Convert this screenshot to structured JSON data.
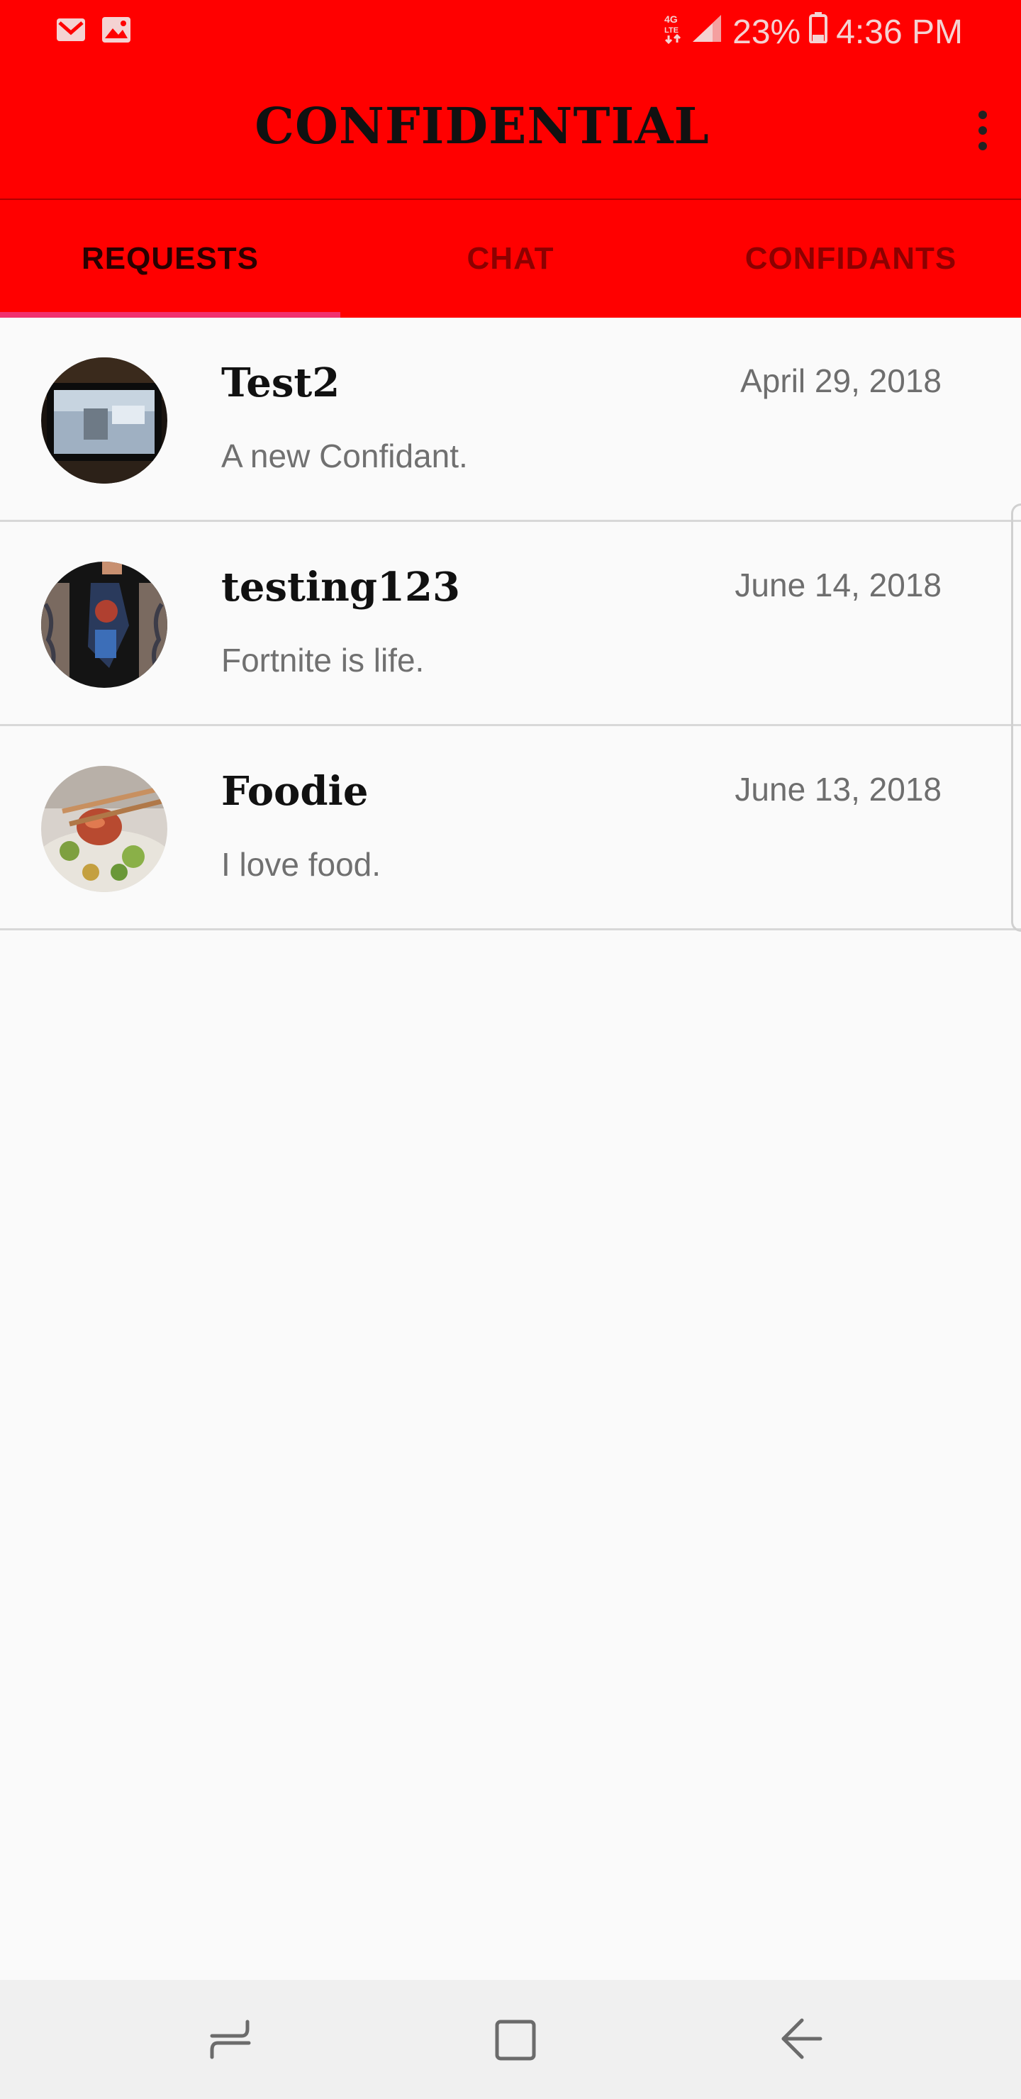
{
  "status_bar": {
    "notification_icons": [
      "gmail-icon",
      "gallery-icon"
    ],
    "network_label": "4G LTE",
    "battery_percent": "23%",
    "time": "4:36 PM"
  },
  "app_bar": {
    "title": "CONFIDENTIAL",
    "menu_icon": "more-vert-icon"
  },
  "tabs": [
    {
      "label": "REQUESTS",
      "active": true
    },
    {
      "label": "CHAT",
      "active": false
    },
    {
      "label": "CONFIDANTS",
      "active": false
    }
  ],
  "requests": [
    {
      "name": "Test2",
      "date": "April 29, 2018",
      "message": "A new Confidant."
    },
    {
      "name": "testing123",
      "date": "June 14, 2018",
      "message": "Fortnite is life."
    },
    {
      "name": "Foodie",
      "date": "June 13, 2018",
      "message": "I love food."
    }
  ],
  "nav_bar": {
    "buttons": [
      "recents-icon",
      "home-icon",
      "back-icon"
    ]
  },
  "colors": {
    "accent": "#ff0000",
    "tab_indicator": "#f1306e",
    "background": "#fafafa"
  }
}
